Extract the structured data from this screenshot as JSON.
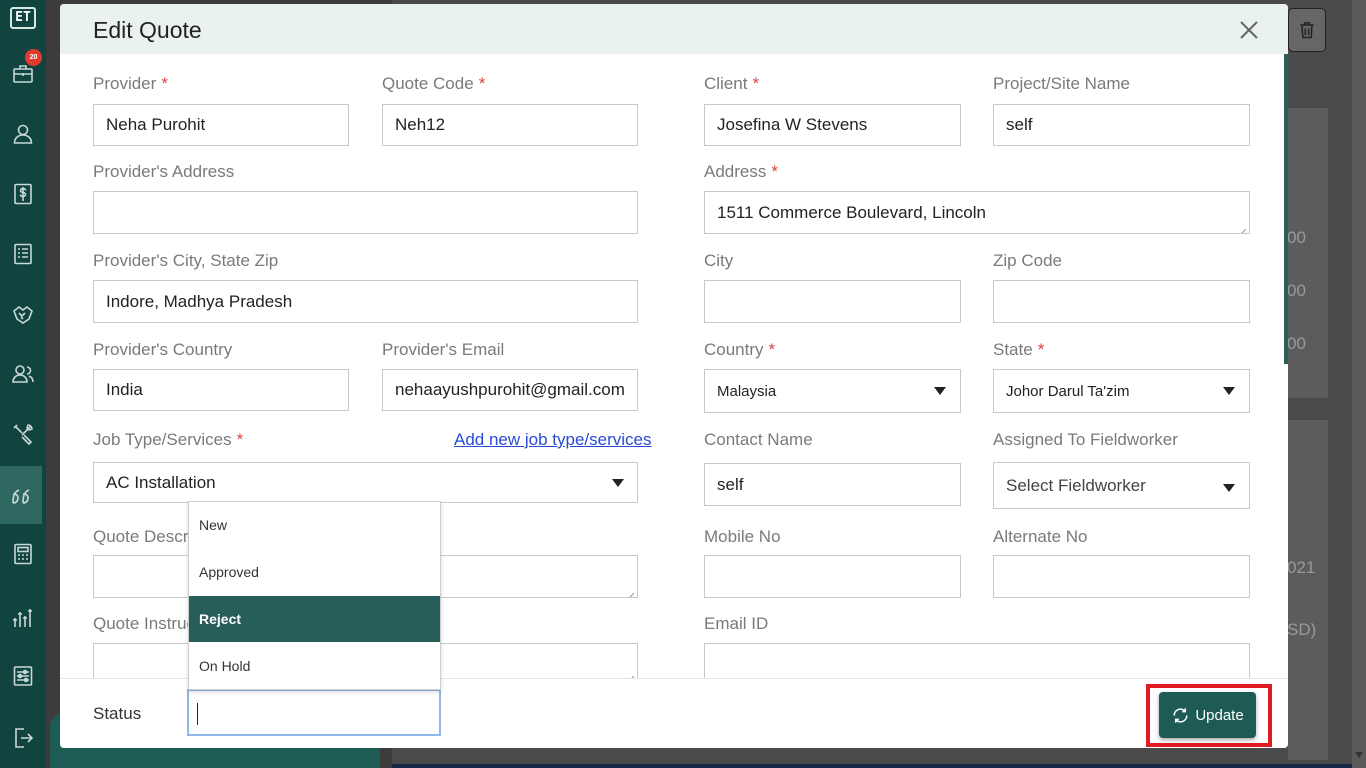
{
  "app": {
    "logo_text": "ET",
    "notification_count": "20"
  },
  "sidebar": {
    "items": [
      {
        "name": "briefcase-icon"
      },
      {
        "name": "user-icon"
      },
      {
        "name": "dollar-icon"
      },
      {
        "name": "list-icon"
      },
      {
        "name": "handshake-icon"
      },
      {
        "name": "users-icon"
      },
      {
        "name": "tools-icon"
      },
      {
        "name": "quotes-icon",
        "active": true
      },
      {
        "name": "calculator-icon"
      },
      {
        "name": "bar-chart-icon"
      },
      {
        "name": "settings-sliders-icon"
      },
      {
        "name": "logout-icon"
      }
    ]
  },
  "background": {
    "fragments": [
      "00",
      "00",
      "00",
      "021",
      "SD)"
    ]
  },
  "modal": {
    "title": "Edit Quote",
    "fields": {
      "provider": {
        "label": "Provider",
        "value": "Neha Purohit"
      },
      "quote_code": {
        "label": "Quote Code",
        "value": "Neh12"
      },
      "client": {
        "label": "Client",
        "value": "Josefina W Stevens"
      },
      "project": {
        "label": "Project/Site Name",
        "value": "self"
      },
      "provider_address": {
        "label": "Provider's Address",
        "value": ""
      },
      "address": {
        "label": "Address",
        "value": "1511  Commerce Boulevard, Lincoln"
      },
      "provider_city": {
        "label": "Provider's City, State Zip",
        "value": "Indore, Madhya Pradesh"
      },
      "city": {
        "label": "City",
        "value": ""
      },
      "zip": {
        "label": "Zip Code",
        "value": ""
      },
      "provider_country": {
        "label": "Provider's Country",
        "value": "India"
      },
      "provider_email": {
        "label": "Provider's Email",
        "value": "nehaayushpurohit@gmail.com"
      },
      "country": {
        "label": "Country",
        "value": "Malaysia"
      },
      "state": {
        "label": "State",
        "value": "Johor Darul Ta'zim"
      },
      "job_type": {
        "label": "Job Type/Services",
        "value": "AC Installation",
        "link": "Add new job type/services"
      },
      "contact_name": {
        "label": "Contact Name",
        "value": "self"
      },
      "fieldworker": {
        "label": "Assigned To Fieldworker",
        "value": "Select Fieldworker"
      },
      "quote_description": {
        "label": "Quote Descrip",
        "value": ""
      },
      "mobile": {
        "label": "Mobile No",
        "value": ""
      },
      "alternate": {
        "label": "Alternate No",
        "value": ""
      },
      "quote_instructions": {
        "label": "Quote Instruc",
        "value": ""
      },
      "email": {
        "label": "Email ID",
        "value": ""
      }
    },
    "status": {
      "label": "Status",
      "value": "",
      "options": [
        "New",
        "Approved",
        "Reject",
        "On Hold"
      ],
      "highlighted": "Reject"
    },
    "update_label": "Update"
  },
  "colors": {
    "sidebar": "#11433f",
    "accent": "#1e5b55",
    "required": "#e04040",
    "link": "#2a4bd7",
    "highlight": "#e01b24"
  }
}
